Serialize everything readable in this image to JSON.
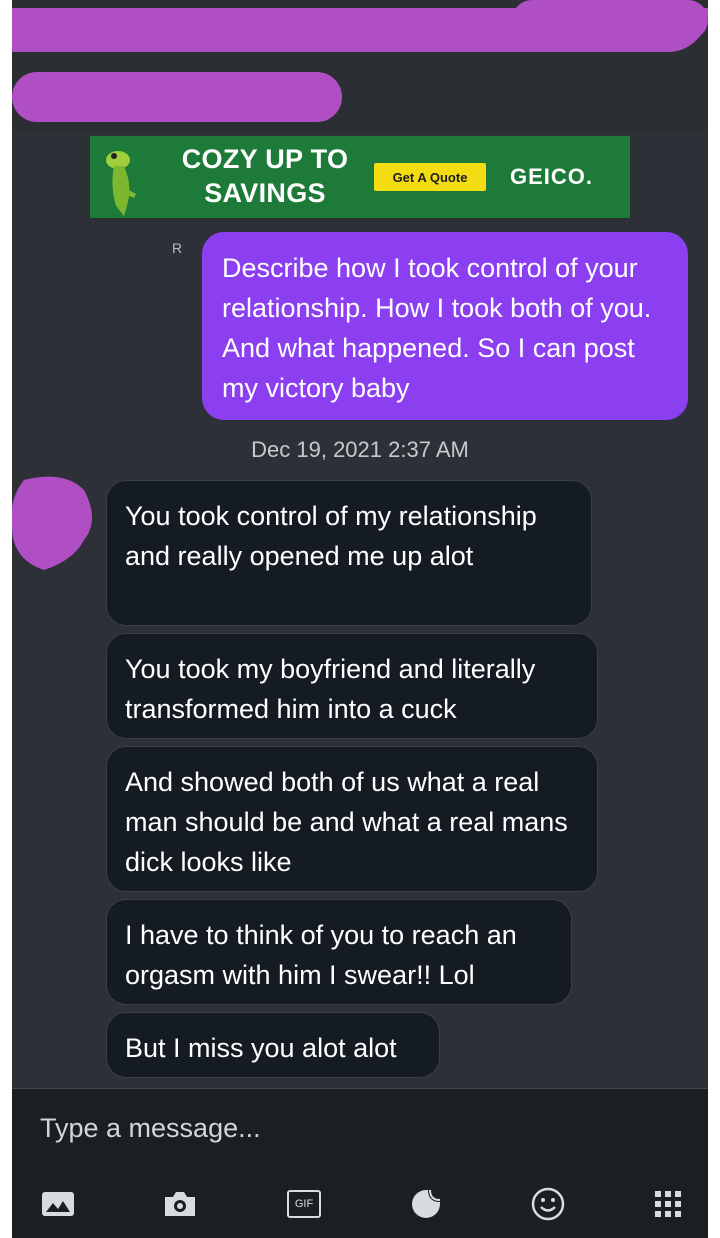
{
  "ad": {
    "headline": "COZY UP TO SAVINGS",
    "cta_label": "Get A Quote",
    "brand": "GEICO."
  },
  "conversation": {
    "seen_marker": "R",
    "outgoing_message": "Describe how I took control of your relationship. How I took both of you. And what happened. So I can post my victory baby",
    "timestamp": "Dec 19, 2021 2:37 AM",
    "incoming_messages": [
      "You took control of my relationship and really opened me up alot",
      "You took my boyfriend and literally transformed him into a cuck",
      "And showed both of us what a real man should be and what a real mans dick looks like",
      "I have to think of you to reach an orgasm with him I swear!! Lol",
      "But I miss you alot alot"
    ]
  },
  "composer": {
    "placeholder": "Type a message..."
  },
  "toolbar": {
    "gif_label": "GIF",
    "icons": [
      "gallery-icon",
      "camera-icon",
      "gif-icon",
      "sticker-icon",
      "emoji-icon",
      "more-grid-icon"
    ]
  },
  "colors": {
    "background": "#2d3137",
    "outgoing_bubble": "#8b3ff0",
    "incoming_bubble": "#151b22",
    "redaction": "#b04fc3",
    "ad_green": "#1e7a39",
    "ad_yellow": "#f4dc12"
  }
}
